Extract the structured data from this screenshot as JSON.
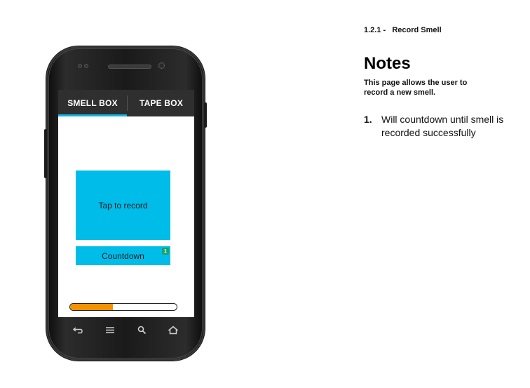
{
  "page": {
    "breadcrumb": "1.2.1 -   Record Smell",
    "notes_title": "Notes",
    "notes_description": "This page allows the user to record a new smell.",
    "notes": [
      {
        "number": "1.",
        "text": "Will countdown until smell is recorded successfully"
      }
    ]
  },
  "app": {
    "tabs": [
      {
        "label": "SMELL BOX",
        "selected": true
      },
      {
        "label": "TAPE BOX",
        "selected": false
      }
    ],
    "record_button_label": "Tap to record",
    "countdown_label": "Countdown",
    "countdown_note_marker": "1",
    "progress_fraction": 0.4,
    "colors": {
      "accent": "#00bce9",
      "tab_bar": "#2f2f2f",
      "tab_indicator": "#11b5e4",
      "progress": "#f39200",
      "note_badge": "#1aa36a"
    }
  },
  "navbar": {
    "icons": [
      "back-icon",
      "menu-icon",
      "search-icon",
      "home-icon"
    ]
  }
}
